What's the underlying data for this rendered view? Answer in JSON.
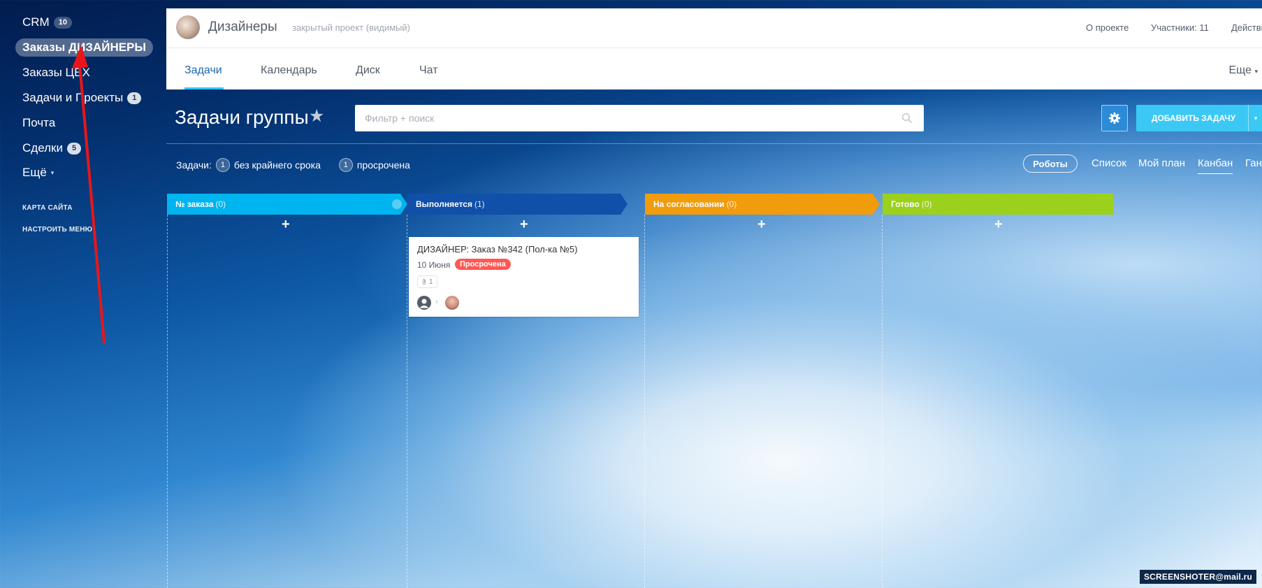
{
  "sidebar": {
    "items": [
      {
        "label": "CRM",
        "count": "10"
      },
      {
        "label": "Заказы ДИЗАЙНЕРЫ"
      },
      {
        "label": "Заказы ЦЕХ"
      },
      {
        "label": "Задачи и Проекты",
        "count": "1"
      },
      {
        "label": "Почта"
      },
      {
        "label": "Сделки",
        "count": "5"
      },
      {
        "label": "Ещё"
      }
    ],
    "site_map": "КАРТА САЙТА",
    "configure_menu": "НАСТРОИТЬ МЕНЮ"
  },
  "header": {
    "project_name": "Дизайнеры",
    "project_type": "закрытый проект (видимый)",
    "about": "О проекте",
    "members": "Участники: 11",
    "actions": "Действия"
  },
  "nav": {
    "tabs": [
      "Задачи",
      "Календарь",
      "Диск",
      "Чат"
    ],
    "more": "Еще"
  },
  "toolbar": {
    "title": "Задачи группы",
    "star": "★",
    "search_placeholder": "Фильтр + поиск",
    "add_task": "ДОБАВИТЬ ЗАДАЧУ"
  },
  "counters": {
    "label": "Задачи:",
    "no_deadline_count": "1",
    "no_deadline": "без крайнего срока",
    "overdue_count": "1",
    "overdue": "просрочена"
  },
  "views": {
    "robots": "Роботы",
    "list": "Список",
    "my_plan": "Мой план",
    "kanban": "Канбан",
    "gantt": "Ган"
  },
  "kanban": {
    "stages": [
      {
        "name": "№ заказа",
        "count": "(0)",
        "color": "#00b4ef"
      },
      {
        "name": "Выполняется",
        "count": "(1)",
        "color": "#1150a8"
      },
      {
        "name": "На согласовании",
        "count": "(0)",
        "color": "#f09c0c"
      },
      {
        "name": "Готово",
        "count": "(0)",
        "color": "#9bd11c"
      }
    ],
    "add": "+",
    "card": {
      "title": "ДИЗАЙНЕР: Заказ №342 (Пол-ка №5)",
      "date": "10 Июня",
      "status": "Просрочена",
      "attachments": "1"
    }
  },
  "watermark": "SCREENSHOTER@mail.ru",
  "colors": {
    "accent": "#2fc6f6",
    "overdue": "#ff5752",
    "arrow": "#e8161a"
  }
}
